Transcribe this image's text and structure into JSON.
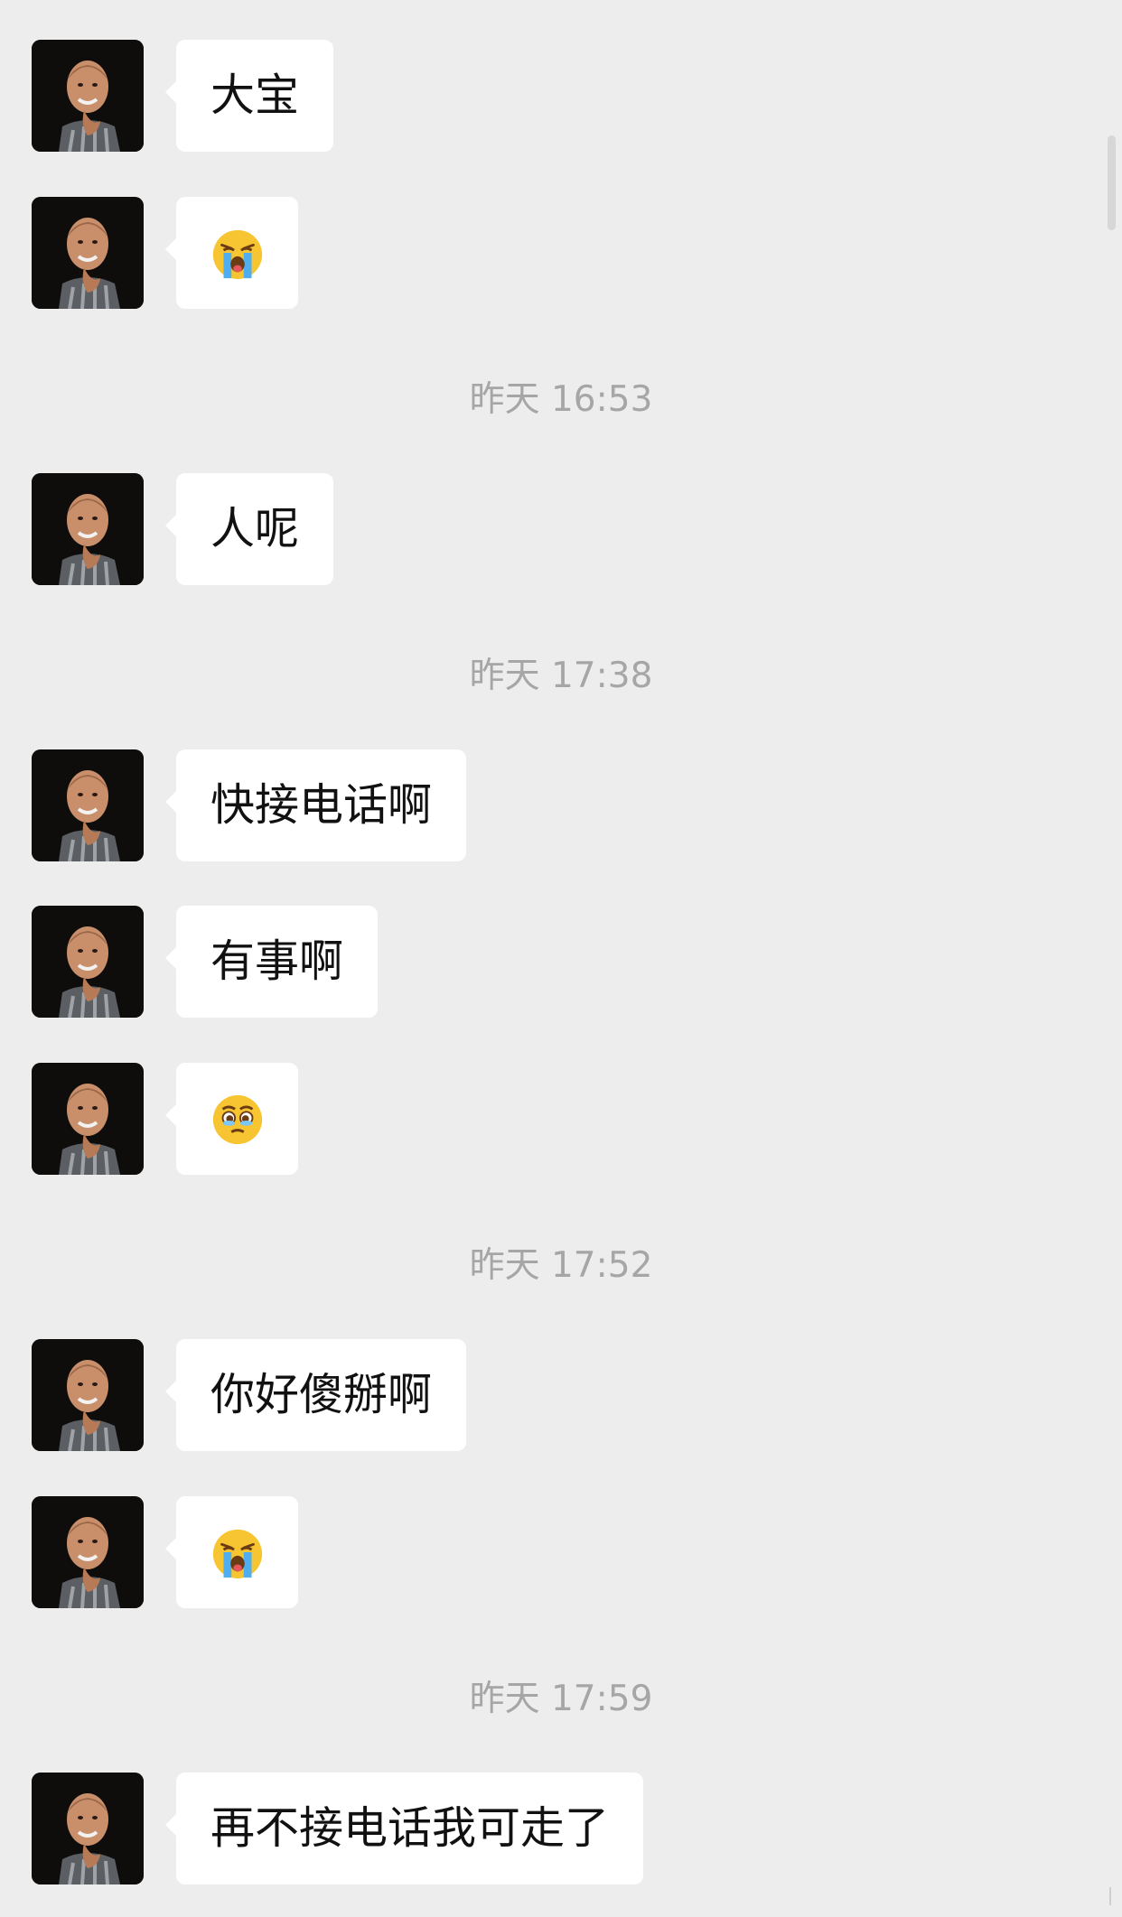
{
  "messages": [
    {
      "type": "text",
      "text": "大宝"
    },
    {
      "type": "emoji",
      "emoji": "loudly-crying-face"
    },
    {
      "type": "time",
      "text": "昨天 16:53"
    },
    {
      "type": "text",
      "text": "人呢"
    },
    {
      "type": "time",
      "text": "昨天 17:38"
    },
    {
      "type": "text",
      "text": "快接电话啊"
    },
    {
      "type": "text",
      "text": "有事啊"
    },
    {
      "type": "emoji",
      "emoji": "face-holding-back-tears"
    },
    {
      "type": "time",
      "text": "昨天 17:52"
    },
    {
      "type": "text",
      "text": "你好傻掰啊"
    },
    {
      "type": "emoji",
      "emoji": "loudly-crying-face"
    },
    {
      "type": "time",
      "text": "昨天 17:59"
    },
    {
      "type": "text",
      "text": "再不接电话我可走了"
    }
  ],
  "colors": {
    "background": "#ededed",
    "bubble": "#ffffff",
    "timestamp": "#a6a6a6",
    "text": "#111111"
  }
}
